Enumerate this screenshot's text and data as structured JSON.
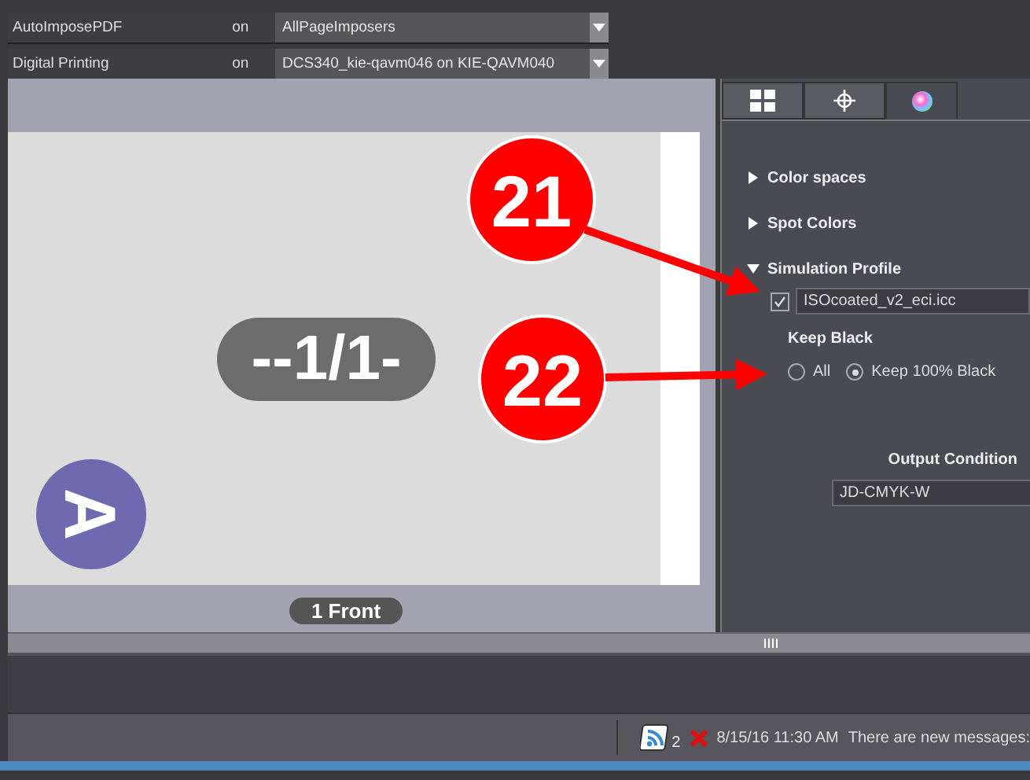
{
  "selectors": [
    {
      "label": "AutoImposePDF",
      "state": "on",
      "value": "AllPageImposers"
    },
    {
      "label": "Digital Printing",
      "state": "on",
      "value": "DCS340_kie-qavm046 on KIE-QAVM040"
    }
  ],
  "preview": {
    "page_label": "--1/1-",
    "corner_letter": "A",
    "side_label": "1 Front"
  },
  "tabs": [
    {
      "kind": "layout",
      "selected": false
    },
    {
      "kind": "crosshair",
      "selected": false
    },
    {
      "kind": "color",
      "selected": true
    }
  ],
  "sections": [
    {
      "label": "Color spaces",
      "expanded": false
    },
    {
      "label": "Spot Colors",
      "expanded": false
    },
    {
      "label": "Simulation Profile",
      "expanded": true
    }
  ],
  "simulation_profile": {
    "checked": true,
    "value": "ISOcoated_v2_eci.icc"
  },
  "keep_black": {
    "label": "Keep Black",
    "options": [
      {
        "label": "All",
        "selected": false
      },
      {
        "label": "Keep 100% Black",
        "selected": true
      }
    ]
  },
  "output_condition": {
    "label": "Output Condition",
    "value": "JD-CMYK-W"
  },
  "callouts": [
    {
      "number": "21"
    },
    {
      "number": "22"
    }
  ],
  "status_bar": {
    "feed_count": "2",
    "timestamp": "8/15/16 11:30 AM",
    "message": "There are new messages:"
  }
}
